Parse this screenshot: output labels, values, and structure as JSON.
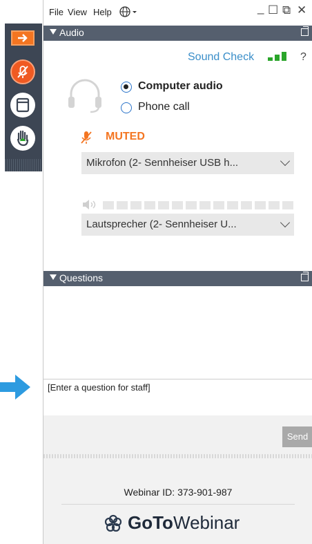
{
  "menu": {
    "file": "File",
    "view": "View",
    "help": "Help"
  },
  "window_controls": {
    "minimize": "_",
    "maximize": "☐",
    "restore": "⧉",
    "close": "✕"
  },
  "audio": {
    "section_title": "Audio",
    "sound_check": "Sound Check",
    "help": "?",
    "options": [
      {
        "label": "Computer audio",
        "selected": true
      },
      {
        "label": "Phone call",
        "selected": false
      }
    ],
    "muted_label": "MUTED",
    "microphone": "Mikrofon (2- Sennheiser USB h...",
    "speaker": "Lautsprecher (2- Sennheiser U..."
  },
  "questions": {
    "section_title": "Questions",
    "input_text": "[Enter a question for staff]",
    "send": "Send"
  },
  "footer": {
    "webinar_id": "Webinar ID: 373-901-987",
    "brand_bold": "GoTo",
    "brand_light": "Webinar"
  },
  "colors": {
    "accent_orange": "#f47521",
    "link_blue": "#3a8ec9",
    "section_bar": "#555f6e",
    "toolbar": "#3d4654",
    "signal_green": "#2aa52a"
  },
  "toolbar_icons": [
    "collapse-arrow-icon",
    "mic-muted-icon",
    "window-icon",
    "raise-hand-icon"
  ]
}
